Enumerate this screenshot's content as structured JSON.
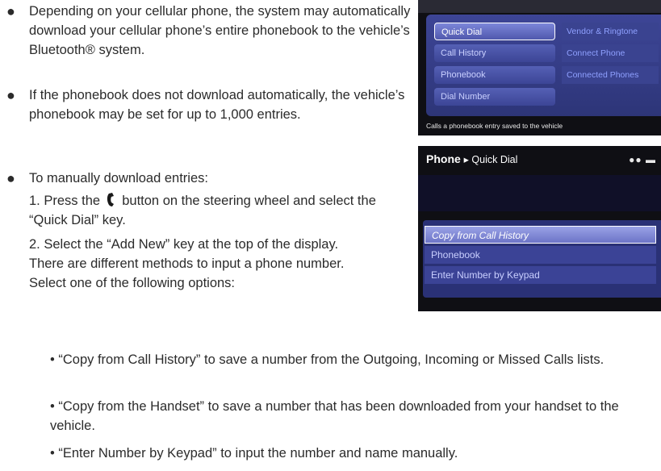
{
  "bullets": [
    "Depending on your cellular phone, the system may automatically download your cellular phone’s entire phonebook to the vehicle’s Bluetooth® system.",
    "If the phonebook does not download automatically, the vehicle’s phonebook may be set for up to 1,000 entries.",
    "To manually download entries:"
  ],
  "steps": {
    "step1_before": "1. Press the",
    "step1_after": "button on the steering wheel and select the “Quick Dial” key.",
    "step2": "2. Select the “Add New” key at the top of the display. There are different methods to input a phone number. Select one of the following options:"
  },
  "options": [
    "“Copy from Call History” to save a number from the Outgoing, Incoming or Missed Calls lists.",
    "“Copy from the Handset” to save a number that has been downloaded from your handset to the vehicle.",
    "“Enter Number by Keypad” to input the number and name manually."
  ],
  "screen1": {
    "left_keys": [
      "Quick Dial",
      "Call History",
      "Phonebook",
      "Dial Number"
    ],
    "right_keys": [
      "Vendor & Ringtone",
      "Connect Phone",
      "Connected Phones"
    ],
    "status": "Calls a phonebook entry saved to the vehicle"
  },
  "screen2": {
    "title": "Phone",
    "crumb": "Quick Dial",
    "items": [
      "Copy from Call History",
      "Phonebook",
      "Enter Number by Keypad"
    ]
  },
  "icons": {
    "phone": "phone-handset-icon",
    "status": "signal-battery-icon"
  }
}
